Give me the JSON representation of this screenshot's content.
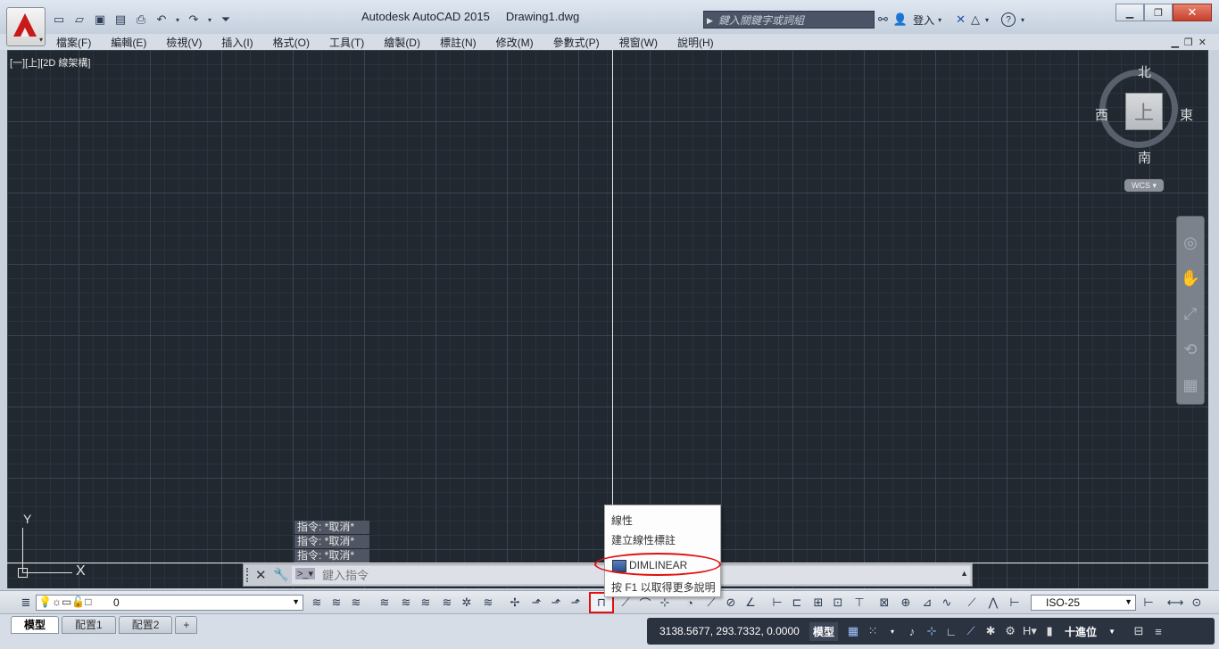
{
  "title_bar": {
    "app_name": "Autodesk AutoCAD 2015",
    "document": "Drawing1.dwg",
    "search_placeholder": "鍵入關鍵字或詞組",
    "sign_in": "登入"
  },
  "menu": {
    "items": [
      "檔案(F)",
      "編輯(E)",
      "檢視(V)",
      "插入(I)",
      "格式(O)",
      "工具(T)",
      "繪製(D)",
      "標註(N)",
      "修改(M)",
      "參數式(P)",
      "視窗(W)",
      "說明(H)"
    ]
  },
  "viewport": {
    "label": "[一][上][2D 線架構]",
    "ucs_x": "X",
    "ucs_y": "Y"
  },
  "viewcube": {
    "north": "北",
    "south": "南",
    "east": "東",
    "west": "西",
    "face": "上",
    "wcs": "WCS"
  },
  "command_history": [
    "指令: *取消*",
    "指令: *取消*",
    "指令: *取消*"
  ],
  "command_line": {
    "placeholder": "鍵入指令"
  },
  "tooltip": {
    "title": "線性",
    "description": "建立線性標註",
    "command": "DIMLINEAR",
    "help": "按 F1 以取得更多說明"
  },
  "toolbar": {
    "layer_value": "0",
    "dimstyle_value": "ISO-25"
  },
  "status": {
    "tabs": [
      "模型",
      "配置1",
      "配置2"
    ],
    "coordinates": "3138.5677, 293.7332, 0.0000",
    "model_label": "模型",
    "units_label": "十進位"
  },
  "colors": {
    "canvas_bg": "#212830",
    "highlight_red": "#e01010",
    "autocad_red": "#c81a1a"
  }
}
